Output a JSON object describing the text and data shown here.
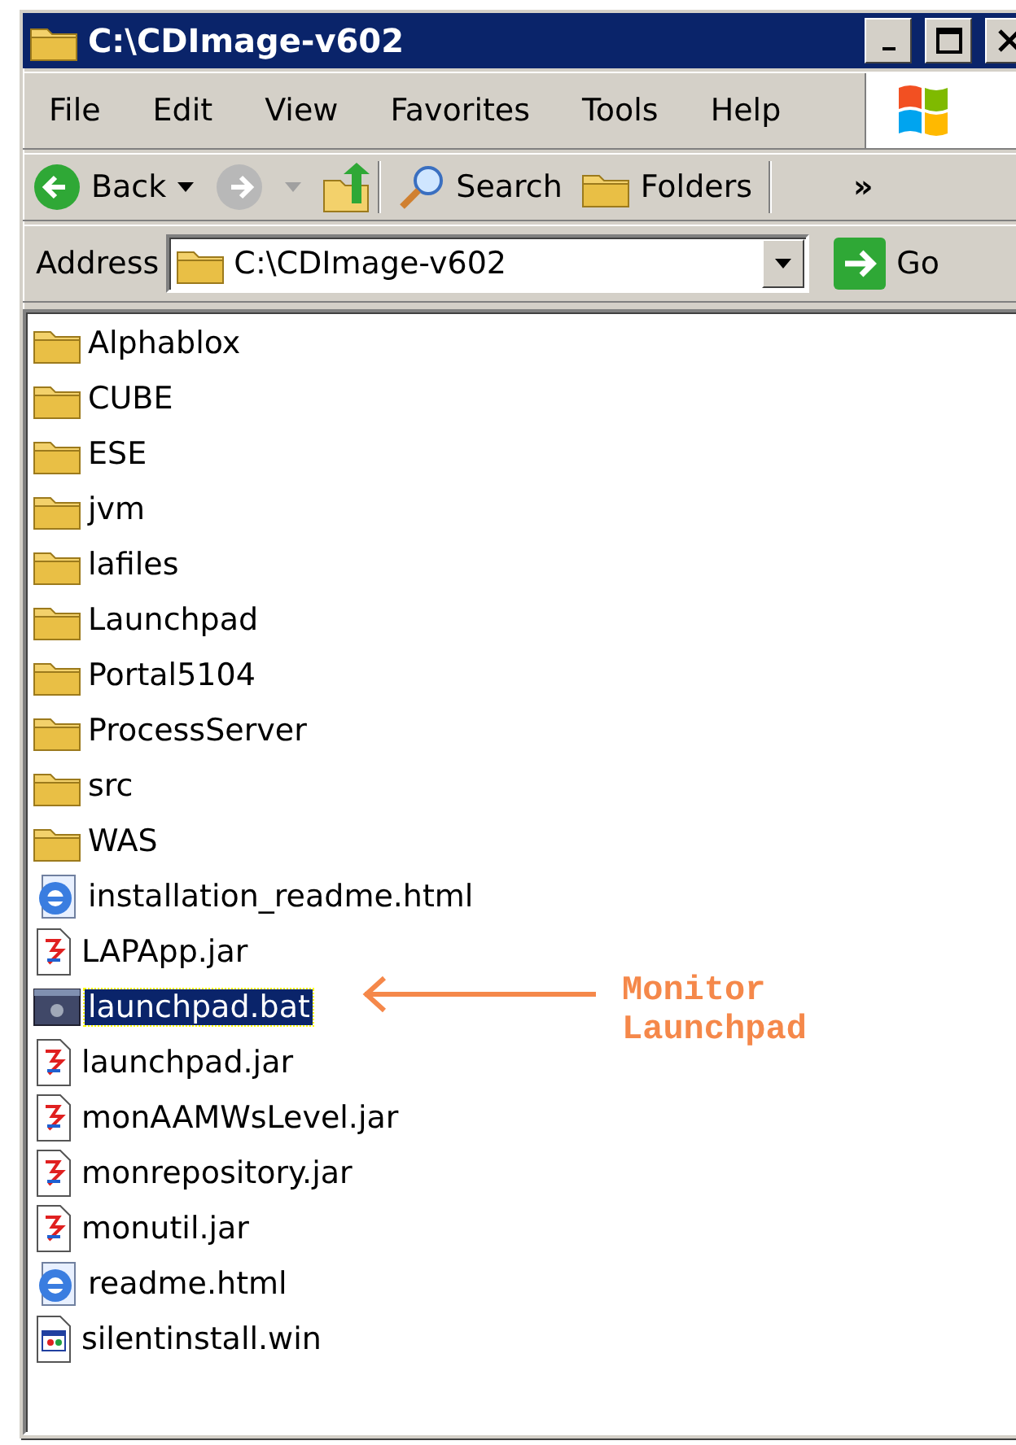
{
  "window": {
    "title": "C:\\CDImage-v602"
  },
  "menu": [
    "File",
    "Edit",
    "View",
    "Favorites",
    "Tools",
    "Help"
  ],
  "toolbar": {
    "back": "Back",
    "search": "Search",
    "folders": "Folders",
    "more": "»"
  },
  "address": {
    "label": "Address",
    "value": "C:\\CDImage-v602",
    "go": "Go"
  },
  "files": [
    {
      "name": "Alphablox",
      "kind": "folder",
      "selected": false
    },
    {
      "name": "CUBE",
      "kind": "folder",
      "selected": false
    },
    {
      "name": "ESE",
      "kind": "folder",
      "selected": false
    },
    {
      "name": "jvm",
      "kind": "folder",
      "selected": false
    },
    {
      "name": "lafiles",
      "kind": "folder",
      "selected": false
    },
    {
      "name": "Launchpad",
      "kind": "folder",
      "selected": false
    },
    {
      "name": "Portal5104",
      "kind": "folder",
      "selected": false
    },
    {
      "name": "ProcessServer",
      "kind": "folder",
      "selected": false
    },
    {
      "name": "src",
      "kind": "folder",
      "selected": false
    },
    {
      "name": "WAS",
      "kind": "folder",
      "selected": false
    },
    {
      "name": "installation_readme.html",
      "kind": "html",
      "selected": false
    },
    {
      "name": "LAPApp.jar",
      "kind": "jar",
      "selected": false
    },
    {
      "name": "launchpad.bat",
      "kind": "bat",
      "selected": true
    },
    {
      "name": "launchpad.jar",
      "kind": "jar",
      "selected": false
    },
    {
      "name": "monAAMWsLevel.jar",
      "kind": "jar",
      "selected": false
    },
    {
      "name": "monrepository.jar",
      "kind": "jar",
      "selected": false
    },
    {
      "name": "monutil.jar",
      "kind": "jar",
      "selected": false
    },
    {
      "name": "readme.html",
      "kind": "html",
      "selected": false
    },
    {
      "name": "silentinstall.win",
      "kind": "win",
      "selected": false
    }
  ],
  "annotation": {
    "lines": [
      "Monitor",
      "Launchpad"
    ]
  }
}
